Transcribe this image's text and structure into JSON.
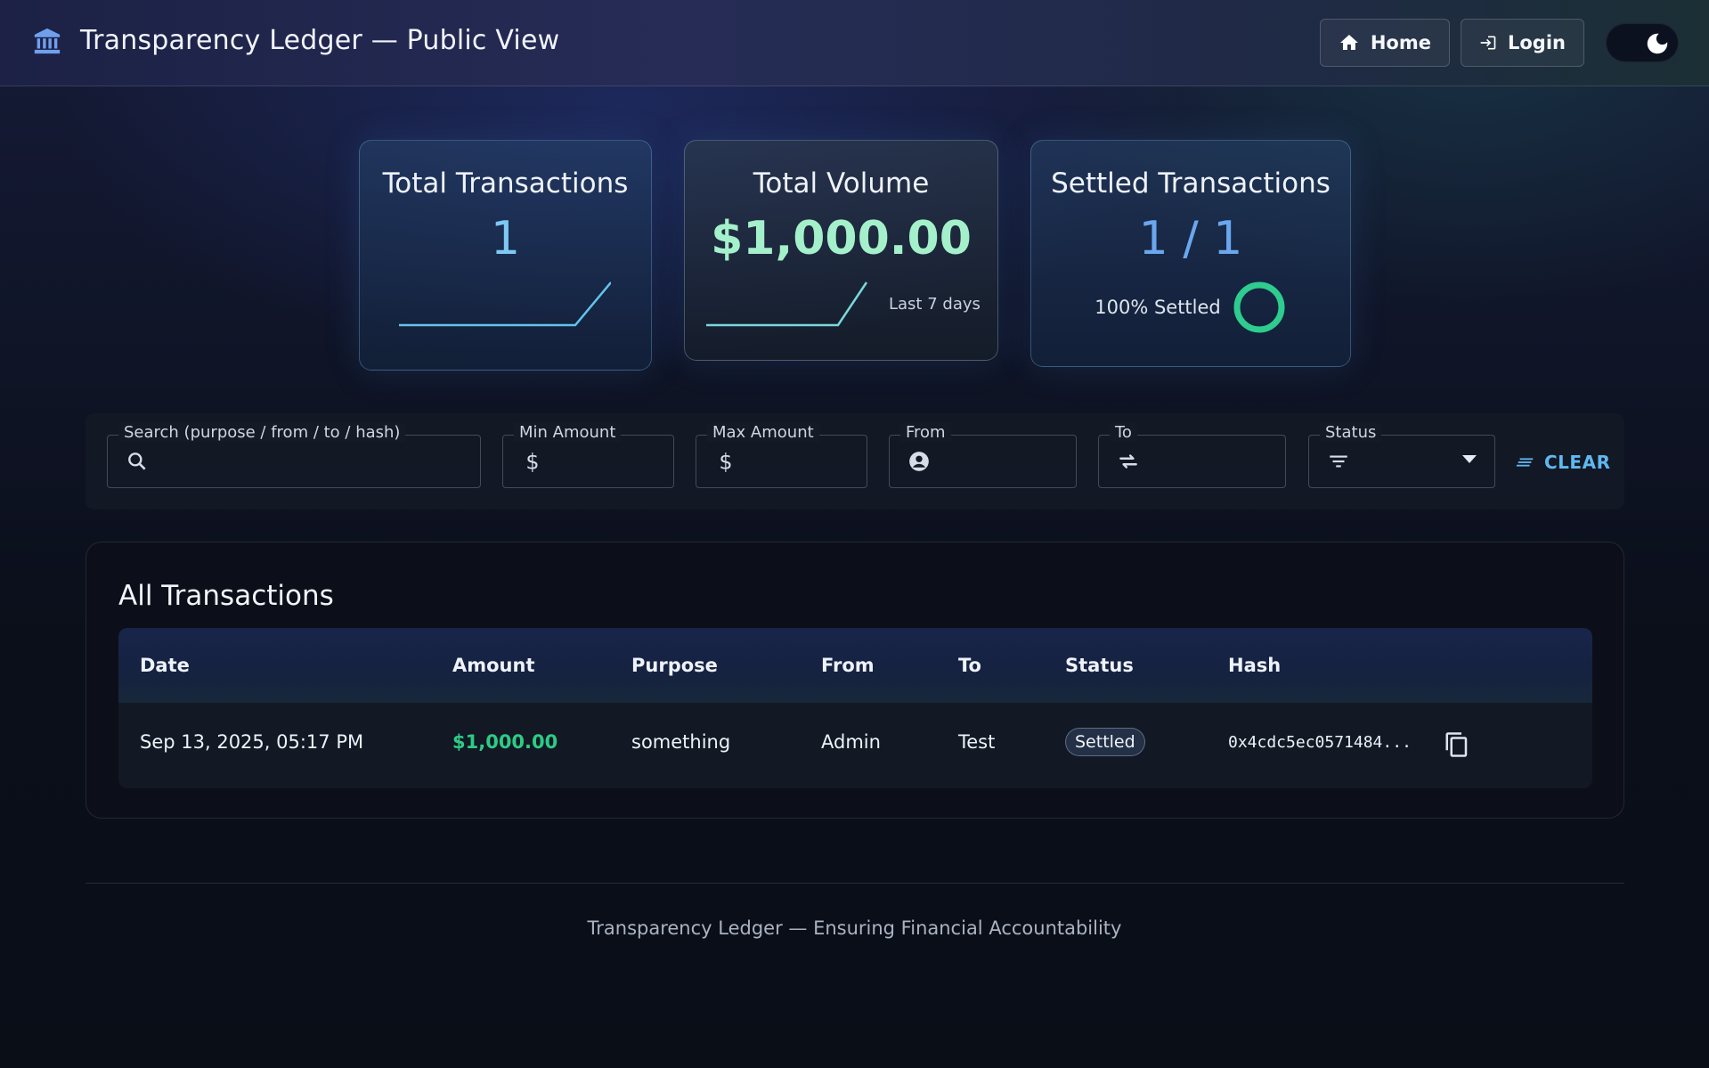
{
  "header": {
    "title": "Transparency Ledger — Public View",
    "home_label": "Home",
    "login_label": "Login",
    "brand_icon": "bank-icon",
    "theme_toggle": "dark"
  },
  "stats": {
    "total_transactions": {
      "title": "Total Transactions",
      "value": "1"
    },
    "total_volume": {
      "title": "Total Volume",
      "value": "$1,000.00",
      "caption": "Last 7 days"
    },
    "settled": {
      "title": "Settled Transactions",
      "value": "1 / 1",
      "caption": "100% Settled",
      "percent": 100
    }
  },
  "filters": {
    "search_label": "Search (purpose / from / to / hash)",
    "search_value": "",
    "min_label": "Min Amount",
    "min_value": "",
    "max_label": "Max Amount",
    "max_value": "",
    "from_label": "From",
    "from_value": "",
    "to_label": "To",
    "to_value": "",
    "status_label": "Status",
    "status_value": "",
    "clear_label": "CLEAR"
  },
  "transactions": {
    "title": "All Transactions",
    "columns": [
      "Date",
      "Amount",
      "Purpose",
      "From",
      "To",
      "Status",
      "Hash"
    ],
    "rows": [
      {
        "date": "Sep 13, 2025, 05:17 PM",
        "amount": "$1,000.00",
        "purpose": "something",
        "from": "Admin",
        "to": "Test",
        "status": "Settled",
        "hash": "0x4cdc5ec0571484..."
      }
    ]
  },
  "colors": {
    "accent": "#5fb8f0",
    "amount": "#2ecb86",
    "settled_ring": "#2ecc8f"
  },
  "footer": {
    "text": "Transparency Ledger — Ensuring Financial Accountability"
  }
}
